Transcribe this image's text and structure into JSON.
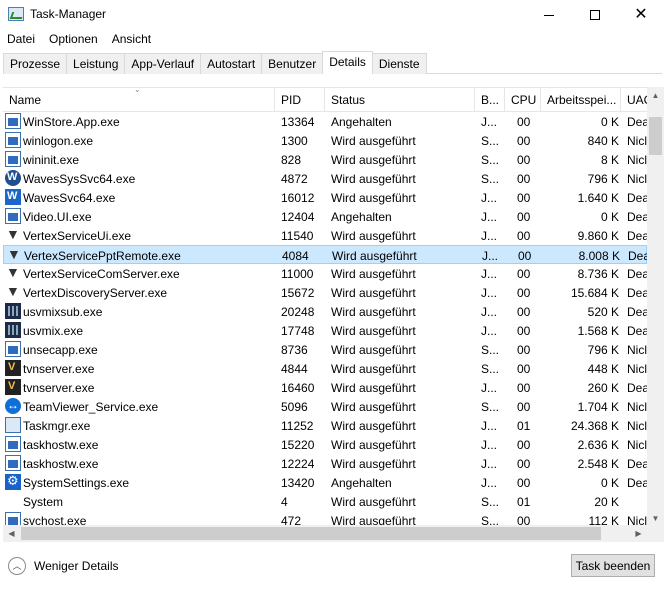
{
  "window": {
    "title": "Task-Manager"
  },
  "menu": [
    "Datei",
    "Optionen",
    "Ansicht"
  ],
  "tabs": [
    {
      "label": "Prozesse",
      "active": false
    },
    {
      "label": "Leistung",
      "active": false
    },
    {
      "label": "App-Verlauf",
      "active": false
    },
    {
      "label": "Autostart",
      "active": false
    },
    {
      "label": "Benutzer",
      "active": false
    },
    {
      "label": "Details",
      "active": true
    },
    {
      "label": "Dienste",
      "active": false
    }
  ],
  "columns": {
    "name": "Name",
    "pid": "PID",
    "status": "Status",
    "b": "B...",
    "cpu": "CPU",
    "mem": "Arbeitsspei...",
    "uac": "UAC"
  },
  "rows": [
    {
      "icon": "app-window-icon",
      "name": "WinStore.App.exe",
      "pid": "13364",
      "status": "Angehalten",
      "b": "J...",
      "cpu": "00",
      "mem": "0 K",
      "uac": "Dea",
      "selected": false
    },
    {
      "icon": "app-window-icon",
      "name": "winlogon.exe",
      "pid": "1300",
      "status": "Wird ausgeführt",
      "b": "S...",
      "cpu": "00",
      "mem": "840 K",
      "uac": "Nicl",
      "selected": false
    },
    {
      "icon": "app-window-icon",
      "name": "wininit.exe",
      "pid": "828",
      "status": "Wird ausgeführt",
      "b": "S...",
      "cpu": "00",
      "mem": "8 K",
      "uac": "Nicl",
      "selected": false
    },
    {
      "icon": "waves-circle-icon",
      "name": "WavesSysSvc64.exe",
      "pid": "4872",
      "status": "Wird ausgeführt",
      "b": "S...",
      "cpu": "00",
      "mem": "796 K",
      "uac": "Nicl",
      "selected": false
    },
    {
      "icon": "waves-box-icon",
      "name": "WavesSvc64.exe",
      "pid": "16012",
      "status": "Wird ausgeführt",
      "b": "J...",
      "cpu": "00",
      "mem": "1.640 K",
      "uac": "Dea",
      "selected": false
    },
    {
      "icon": "app-window-icon",
      "name": "Video.UI.exe",
      "pid": "12404",
      "status": "Angehalten",
      "b": "J...",
      "cpu": "00",
      "mem": "0 K",
      "uac": "Dea",
      "selected": false
    },
    {
      "icon": "vertex-icon",
      "name": "VertexServiceUi.exe",
      "pid": "11540",
      "status": "Wird ausgeführt",
      "b": "J...",
      "cpu": "00",
      "mem": "9.860 K",
      "uac": "Dea",
      "selected": false
    },
    {
      "icon": "vertex-icon",
      "name": "VertexServicePptRemote.exe",
      "pid": "4084",
      "status": "Wird ausgeführt",
      "b": "J...",
      "cpu": "00",
      "mem": "8.008 K",
      "uac": "Dea",
      "selected": true
    },
    {
      "icon": "vertex-icon",
      "name": "VertexServiceComServer.exe",
      "pid": "11000",
      "status": "Wird ausgeführt",
      "b": "J...",
      "cpu": "00",
      "mem": "8.736 K",
      "uac": "Dea",
      "selected": false
    },
    {
      "icon": "vertex-icon",
      "name": "VertexDiscoveryServer.exe",
      "pid": "15672",
      "status": "Wird ausgeführt",
      "b": "J...",
      "cpu": "00",
      "mem": "15.684 K",
      "uac": "Dea",
      "selected": false
    },
    {
      "icon": "usv-icon",
      "name": "usvmixsub.exe",
      "pid": "20248",
      "status": "Wird ausgeführt",
      "b": "J...",
      "cpu": "00",
      "mem": "520 K",
      "uac": "Dea",
      "selected": false
    },
    {
      "icon": "usv-icon",
      "name": "usvmix.exe",
      "pid": "17748",
      "status": "Wird ausgeführt",
      "b": "J...",
      "cpu": "00",
      "mem": "1.568 K",
      "uac": "Dea",
      "selected": false
    },
    {
      "icon": "app-window-icon",
      "name": "unsecapp.exe",
      "pid": "8736",
      "status": "Wird ausgeführt",
      "b": "S...",
      "cpu": "00",
      "mem": "796 K",
      "uac": "Nicl",
      "selected": false
    },
    {
      "icon": "tvnserver-icon",
      "name": "tvnserver.exe",
      "pid": "4844",
      "status": "Wird ausgeführt",
      "b": "S...",
      "cpu": "00",
      "mem": "448 K",
      "uac": "Nicl",
      "selected": false
    },
    {
      "icon": "tvnserver-icon",
      "name": "tvnserver.exe",
      "pid": "16460",
      "status": "Wird ausgeführt",
      "b": "J...",
      "cpu": "00",
      "mem": "260 K",
      "uac": "Dea",
      "selected": false
    },
    {
      "icon": "teamviewer-icon",
      "name": "TeamViewer_Service.exe",
      "pid": "5096",
      "status": "Wird ausgeführt",
      "b": "S...",
      "cpu": "00",
      "mem": "1.704 K",
      "uac": "Nicl",
      "selected": false
    },
    {
      "icon": "taskmgr-icon",
      "name": "Taskmgr.exe",
      "pid": "11252",
      "status": "Wird ausgeführt",
      "b": "J...",
      "cpu": "01",
      "mem": "24.368 K",
      "uac": "Nicl",
      "selected": false
    },
    {
      "icon": "app-window-icon",
      "name": "taskhostw.exe",
      "pid": "15220",
      "status": "Wird ausgeführt",
      "b": "J...",
      "cpu": "00",
      "mem": "2.636 K",
      "uac": "Nicl",
      "selected": false
    },
    {
      "icon": "app-window-icon",
      "name": "taskhostw.exe",
      "pid": "12224",
      "status": "Wird ausgeführt",
      "b": "J...",
      "cpu": "00",
      "mem": "2.548 K",
      "uac": "Dea",
      "selected": false
    },
    {
      "icon": "settings-gear-icon",
      "name": "SystemSettings.exe",
      "pid": "13420",
      "status": "Angehalten",
      "b": "J...",
      "cpu": "00",
      "mem": "0 K",
      "uac": "Dea",
      "selected": false
    },
    {
      "icon": "blank-icon",
      "name": "System",
      "pid": "4",
      "status": "Wird ausgeführt",
      "b": "S...",
      "cpu": "01",
      "mem": "20 K",
      "uac": "",
      "selected": false
    },
    {
      "icon": "app-window-icon",
      "name": "svchost.exe",
      "pid": "472",
      "status": "Wird ausgeführt",
      "b": "S...",
      "cpu": "00",
      "mem": "112 K",
      "uac": "Nicl",
      "selected": false
    }
  ],
  "footer": {
    "fewer_details": "Weniger Details",
    "end_task": "Task beenden"
  }
}
